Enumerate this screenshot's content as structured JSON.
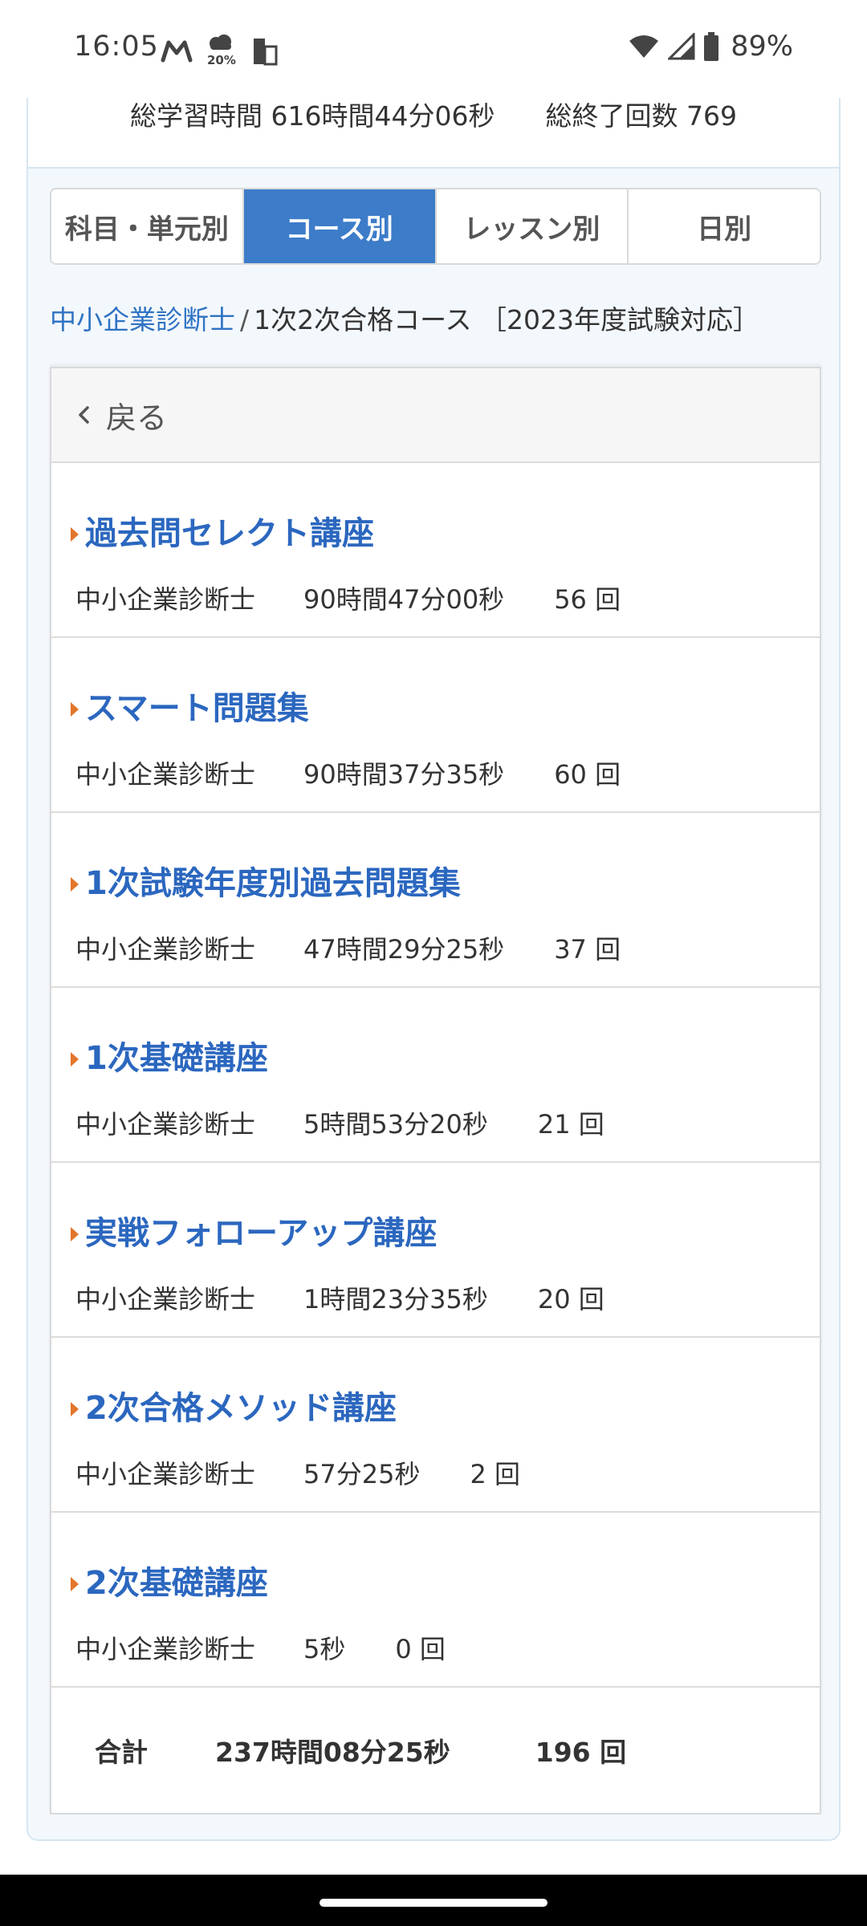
{
  "status_bar": {
    "time": "16:05",
    "weather_percent": "20%",
    "battery_percent": "89%"
  },
  "summary": {
    "total_time_label": "総学習時間",
    "total_time_value": "616時間44分06秒",
    "total_count_label": "総終了回数",
    "total_count_value": "769"
  },
  "tabs": [
    {
      "label": "科目・単元別",
      "active": false
    },
    {
      "label": "コース別",
      "active": true
    },
    {
      "label": "レッスン別",
      "active": false
    },
    {
      "label": "日別",
      "active": false
    }
  ],
  "breadcrumb": {
    "link": "中小企業診断士",
    "separator": "/",
    "current": "1次2次合格コース ［2023年度試験対応］"
  },
  "back_label": "戻る",
  "courses": [
    {
      "name": "過去問セレクト講座",
      "category": "中小企業診断士",
      "time": "90時間47分00秒",
      "count": "56 回"
    },
    {
      "name": "スマート問題集",
      "category": "中小企業診断士",
      "time": "90時間37分35秒",
      "count": "60 回"
    },
    {
      "name": "1次試験年度別過去問題集",
      "category": "中小企業診断士",
      "time": "47時間29分25秒",
      "count": "37 回"
    },
    {
      "name": "1次基礎講座",
      "category": "中小企業診断士",
      "time": "5時間53分20秒",
      "count": "21 回"
    },
    {
      "name": "実戦フォローアップ講座",
      "category": "中小企業診断士",
      "time": "1時間23分35秒",
      "count": "20 回"
    },
    {
      "name": "2次合格メソッド講座",
      "category": "中小企業診断士",
      "time": "57分25秒",
      "count": "2 回"
    },
    {
      "name": "2次基礎講座",
      "category": "中小企業診断士",
      "time": "5秒",
      "count": "0 回"
    }
  ],
  "total": {
    "label": "合計",
    "time": "237時間08分25秒",
    "count": "196 回"
  },
  "colors": {
    "accent_blue": "#3d7cc9",
    "link_blue": "#2b67bf",
    "marker_orange": "#e2762a"
  }
}
